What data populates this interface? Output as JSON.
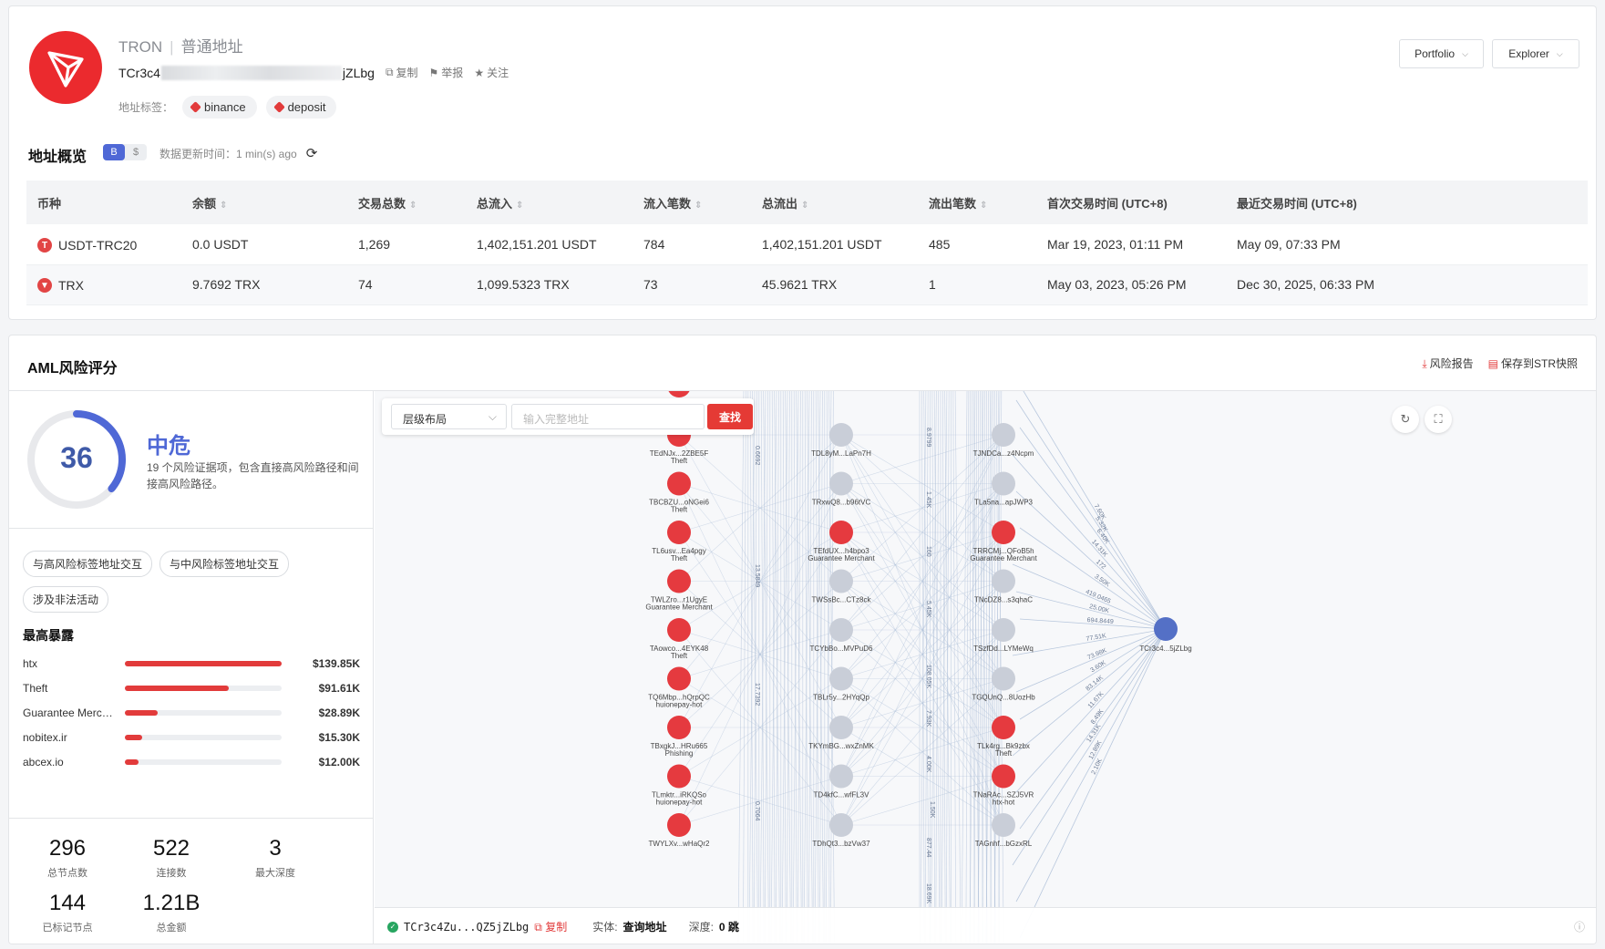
{
  "header": {
    "chain": "TRON",
    "addr_type": "普通地址",
    "address_prefix": "TCr3c4",
    "address_suffix": "jZLbg",
    "copy": "复制",
    "report": "举报",
    "follow": "关注",
    "tags_label": "地址标签：",
    "tags": [
      "binance",
      "deposit"
    ],
    "portfolio": "Portfolio",
    "explorer": "Explorer"
  },
  "overview": {
    "title": "地址概览",
    "toggle": [
      "B",
      "$"
    ],
    "update_label": "数据更新时间：",
    "update_value": "1 min(s) ago",
    "columns": [
      "币种",
      "余额",
      "交易总数",
      "总流入",
      "流入笔数",
      "总流出",
      "流出笔数",
      "首次交易时间 (UTC+8)",
      "最近交易时间 (UTC+8)"
    ],
    "rows": [
      [
        "USDT-TRC20",
        "0.0 USDT",
        "1,269",
        "1,402,151.201 USDT",
        "784",
        "1,402,151.201 USDT",
        "485",
        "Mar 19, 2023, 01:11 PM",
        "May 09, 07:33 PM"
      ],
      [
        "TRX",
        "9.7692 TRX",
        "74",
        "1,099.5323 TRX",
        "73",
        "45.9621 TRX",
        "1",
        "May 03, 2023, 05:26 PM",
        "Dec 30, 2025, 06:33 PM"
      ]
    ]
  },
  "aml": {
    "title": "AML风险评分",
    "risk_report": "风险报告",
    "save_str": "保存到STR快照",
    "score": "36",
    "score_fraction": 0.36,
    "level": "中危",
    "description": "19 个风险证据项，包含直接高风险路径和间接高风险路径。",
    "chips": [
      "与高风险标签地址交互",
      "与中风险标签地址交互",
      "涉及非法活动"
    ],
    "exposure_title": "最高暴露",
    "exposure": [
      {
        "name": "htx",
        "value": "$139.85K",
        "ratio": 1.0
      },
      {
        "name": "Theft",
        "value": "$91.61K",
        "ratio": 0.66
      },
      {
        "name": "Guarantee Merchant",
        "value": "$28.89K",
        "ratio": 0.21
      },
      {
        "name": "nobitex.ir",
        "value": "$15.30K",
        "ratio": 0.11
      },
      {
        "name": "abcex.io",
        "value": "$12.00K",
        "ratio": 0.09
      }
    ],
    "stats": [
      {
        "value": "296",
        "label": "总节点数"
      },
      {
        "value": "522",
        "label": "连接数"
      },
      {
        "value": "3",
        "label": "最大深度"
      },
      {
        "value": "144",
        "label": "已标记节点"
      },
      {
        "value": "1.21B",
        "label": "总金额"
      }
    ]
  },
  "graph": {
    "layout_select": "层级布局",
    "search_placeholder": "输入完整地址",
    "search_button": "查找",
    "footer": {
      "address": "TCr3c4Zu...QZ5jZLbg",
      "copy": "复制",
      "entity_label": "实体:",
      "entity_value": "查询地址",
      "depth_label": "深度:",
      "depth_value": "0 跳"
    },
    "colors": {
      "risk": "#e53a3f",
      "neutral": "#c9ced8",
      "target": "#5470c6",
      "edge": "#a9bcd6"
    },
    "col1_nodes": [
      {
        "label": "TEdNJx...2ZBE5F",
        "tag": "Theft"
      },
      {
        "label": "TBCBZU...oNGei6",
        "tag": "Theft"
      },
      {
        "label": "TL6usv...Ea4pgy",
        "tag": "Theft"
      },
      {
        "label": "TWLZro...r1UgyE",
        "tag": "Guarantee Merchant"
      },
      {
        "label": "TAowco...4EYK48",
        "tag": "Theft"
      },
      {
        "label": "TQ6Mbp...hQrpQC",
        "tag": "huionepay-hot"
      },
      {
        "label": "TBxgkJ...HRu665",
        "tag": "Phishing"
      },
      {
        "label": "TLmktr...iRKQSo",
        "tag": "huionepay-hot"
      },
      {
        "label": "TWYLXv...wHaQr2",
        "tag": ""
      }
    ],
    "col2_nodes": [
      {
        "label": "TDL8yM...LaPn7H",
        "tag": "",
        "risk": false
      },
      {
        "label": "TRxwQ8...b96tVC",
        "tag": "",
        "risk": false
      },
      {
        "label": "TEfdUX...h4bpo3",
        "tag": "Guarantee Merchant",
        "risk": true
      },
      {
        "label": "TWSsBc...CTz8ck",
        "tag": "",
        "risk": false
      },
      {
        "label": "TCYbBo...MVPuD6",
        "tag": "",
        "risk": false
      },
      {
        "label": "TBLr5y...2HYqQp",
        "tag": "",
        "risk": false
      },
      {
        "label": "TKYmBG...wxZnMK",
        "tag": "",
        "risk": false
      },
      {
        "label": "TD4kfC...wfFL3V",
        "tag": "",
        "risk": false
      },
      {
        "label": "TDhQt3...bzVw37",
        "tag": "",
        "risk": false
      }
    ],
    "col3_nodes": [
      {
        "label": "TJNDCa...z4Ncpm",
        "tag": "",
        "risk": false
      },
      {
        "label": "TLa5na...apJWP3",
        "tag": "",
        "risk": false
      },
      {
        "label": "TRRCMj...QFoB5h",
        "tag": "Guarantee Merchant",
        "risk": true
      },
      {
        "label": "TNcDZ8...s3qhaC",
        "tag": "",
        "risk": false
      },
      {
        "label": "TSzfDd...LYMeWq",
        "tag": "",
        "risk": false
      },
      {
        "label": "TGQUnQ...8UozHb",
        "tag": "",
        "risk": false
      },
      {
        "label": "TLk4rg...Bk9zbx",
        "tag": "Theft",
        "risk": true
      },
      {
        "label": "TNaRAc...SZJ5VR",
        "tag": "htx-hot",
        "risk": true
      },
      {
        "label": "TAGnhf...bGzxRL",
        "tag": "",
        "risk": false
      }
    ],
    "target": {
      "label": "TCr3c4...5jZLbg"
    },
    "edge_labels": [
      "7.60K",
      "5.32K",
      "6.40K",
      "14.31K",
      "172",
      "3.50K",
      "419.0465",
      "25.00K",
      "694.8449",
      "77.51K",
      "73.98K",
      "3.60K",
      "83.14K",
      "11.67K",
      "8.49K",
      "14.31K",
      "12.89K",
      "2.10K"
    ],
    "bundle_labels": [
      "0.6692",
      "13.5849",
      "17.7392",
      "0.7064",
      "8.9799",
      "1.45K",
      "160",
      "5.45K",
      "108.05K",
      "7.93K",
      "4.00K",
      "1.50K",
      "877.44",
      "18.69K"
    ]
  }
}
